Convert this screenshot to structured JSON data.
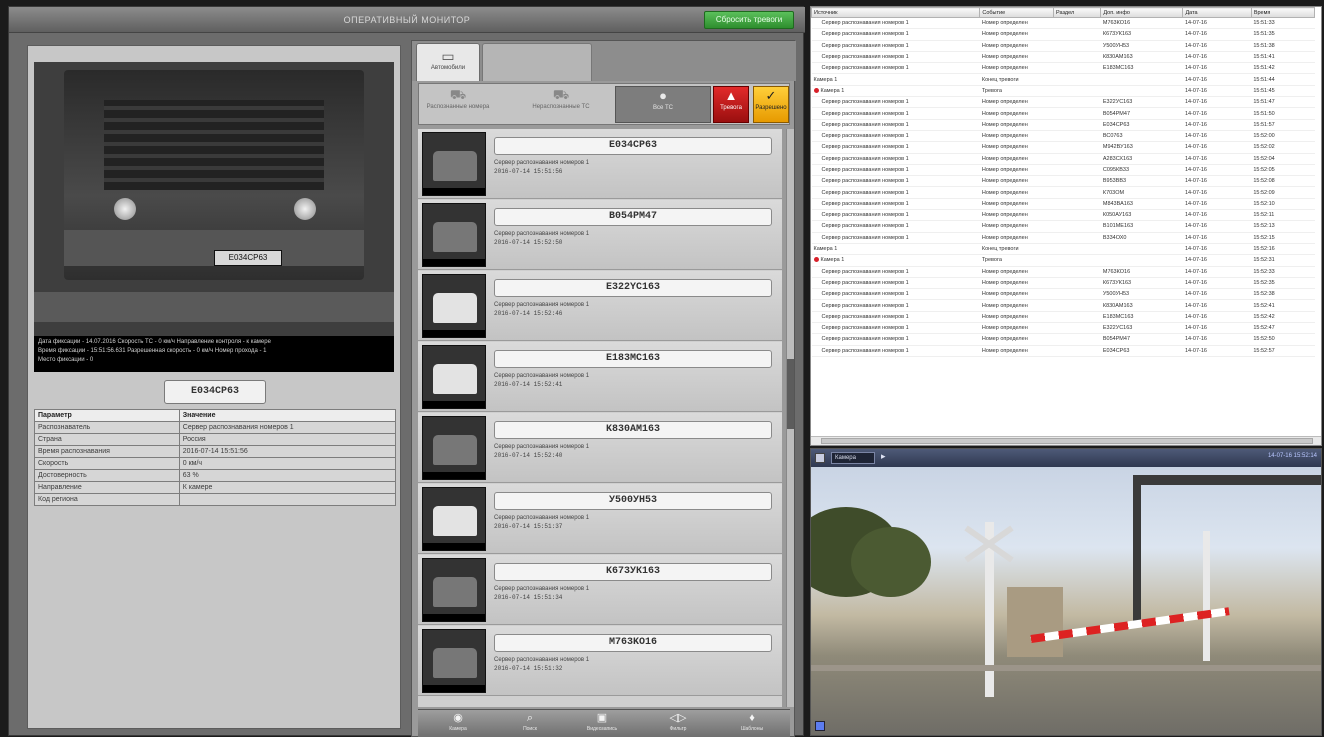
{
  "window": {
    "title": "ОПЕРАТИВНЫЙ МОНИТОР",
    "mode_button": "Сбросить тревоги"
  },
  "detail": {
    "photo_plate": "E034CP63",
    "caption": [
      "Дата фиксации - 14.07.2016 Скорость ТС - 0 км/ч Направление контроля - к камере",
      "Время фиксации - 15:51:56.631    Разрешенная скорость - 0 км/ч    Номер прохода - 1",
      "Место фиксации - 0"
    ],
    "plate": "E034CP63",
    "table_headers": [
      "Параметр",
      "Значение"
    ],
    "table_rows": [
      [
        "Распознаватель",
        "Сервер распознавания номеров 1"
      ],
      [
        "Страна",
        "Россия"
      ],
      [
        "Время распознавания",
        "2016-07-14 15:51:56"
      ],
      [
        "Скорость",
        "0 км/ч"
      ],
      [
        "Достоверность",
        "63 %"
      ],
      [
        "Направление",
        "К камере"
      ],
      [
        "Код региона",
        ""
      ]
    ]
  },
  "middle": {
    "tabs": [
      {
        "label": "Автомобили",
        "icon": "monitor-icon"
      },
      {
        "label": "",
        "icon": "blank"
      }
    ],
    "filters": [
      {
        "label": "Распознанные номера",
        "icon": "car-icon"
      },
      {
        "label": "Нераспознанные ТС",
        "icon": "car-question-icon"
      },
      {
        "label": "Все ТС",
        "icon": "circle-icon"
      },
      {
        "label": "Тревога",
        "icon": "alarm-icon"
      },
      {
        "label": "Разрешено",
        "icon": "check-icon"
      }
    ],
    "items": [
      {
        "plate": "E034CP63",
        "server": "Сервер распознавания номеров 1",
        "time": "2016-07-14 15:51:56",
        "light": false
      },
      {
        "plate": "B054PM47",
        "server": "Сервер распознавания номеров 1",
        "time": "2016-07-14 15:52:50",
        "light": false
      },
      {
        "plate": "E322YC163",
        "server": "Сервер распознавания номеров 1",
        "time": "2016-07-14 15:52:46",
        "light": true
      },
      {
        "plate": "E183MC163",
        "server": "Сервер распознавания номеров 1",
        "time": "2016-07-14 15:52:41",
        "light": true
      },
      {
        "plate": "K830AM163",
        "server": "Сервер распознавания номеров 1",
        "time": "2016-07-14 15:52:40",
        "light": false
      },
      {
        "plate": "У500УН53",
        "server": "Сервер распознавания номеров 1",
        "time": "2016-07-14 15:51:37",
        "light": true
      },
      {
        "plate": "K673УК163",
        "server": "Сервер распознавания номеров 1",
        "time": "2016-07-14 15:51:34",
        "light": false
      },
      {
        "plate": "M763KO16",
        "server": "Сервер распознавания номеров 1",
        "time": "2016-07-14 15:51:32",
        "light": false
      }
    ],
    "toolbar": [
      {
        "label": "Камера",
        "icon": "camera-icon"
      },
      {
        "label": "Поиск",
        "icon": "search-icon"
      },
      {
        "label": "Видеозапись",
        "icon": "video-icon"
      },
      {
        "label": "Фильтр",
        "icon": "filter-icon"
      },
      {
        "label": "Шаблоны",
        "icon": "pin-icon"
      }
    ]
  },
  "events": {
    "headers": [
      "Источник",
      "Событие",
      "Раздел",
      "Доп. инфо",
      "Дата",
      "Время"
    ],
    "rows": [
      {
        "kind": "srv",
        "source": "Сервер распознавания номеров 1",
        "event": "Номер определен",
        "info": "М763КО16",
        "date": "14-07-16",
        "time": "15:51:33"
      },
      {
        "kind": "srv",
        "source": "Сервер распознавания номеров 1",
        "event": "Номер определен",
        "info": "К673УК163",
        "date": "14-07-16",
        "time": "15:51:35"
      },
      {
        "kind": "srv",
        "source": "Сервер распознавания номеров 1",
        "event": "Номер определен",
        "info": "У500УН53",
        "date": "14-07-16",
        "time": "15:51:38"
      },
      {
        "kind": "srv",
        "source": "Сервер распознавания номеров 1",
        "event": "Номер определен",
        "info": "К830АМ163",
        "date": "14-07-16",
        "time": "15:51:41"
      },
      {
        "kind": "srv",
        "source": "Сервер распознавания номеров 1",
        "event": "Номер определен",
        "info": "Е183МС163",
        "date": "14-07-16",
        "time": "15:51:42"
      },
      {
        "kind": "group",
        "source": "Камера 1",
        "event": "Конец тревоги",
        "info": "",
        "date": "14-07-16",
        "time": "15:51:44"
      },
      {
        "kind": "alarm",
        "source": "Камера 1",
        "event": "Тревога",
        "info": "",
        "date": "14-07-16",
        "time": "15:51:45"
      },
      {
        "kind": "srv",
        "source": "Сервер распознавания номеров 1",
        "event": "Номер определен",
        "info": "Е322УС163",
        "date": "14-07-16",
        "time": "15:51:47"
      },
      {
        "kind": "srv",
        "source": "Сервер распознавания номеров 1",
        "event": "Номер определен",
        "info": "В054РМ47",
        "date": "14-07-16",
        "time": "15:51:50"
      },
      {
        "kind": "srv",
        "source": "Сервер распознавания номеров 1",
        "event": "Номер определен",
        "info": "Е034СР63",
        "date": "14-07-16",
        "time": "15:51:57"
      },
      {
        "kind": "srv",
        "source": "Сервер распознавания номеров 1",
        "event": "Номер определен",
        "info": "ВС0763",
        "date": "14-07-16",
        "time": "15:52:00"
      },
      {
        "kind": "srv",
        "source": "Сервер распознавания номеров 1",
        "event": "Номер определен",
        "info": "М942ВУ163",
        "date": "14-07-16",
        "time": "15:52:02"
      },
      {
        "kind": "srv",
        "source": "Сервер распознавания номеров 1",
        "event": "Номер определен",
        "info": "А283СХ163",
        "date": "14-07-16",
        "time": "15:52:04"
      },
      {
        "kind": "srv",
        "source": "Сервер распознавания номеров 1",
        "event": "Номер определен",
        "info": "С095КВ33",
        "date": "14-07-16",
        "time": "15:52:05"
      },
      {
        "kind": "srv",
        "source": "Сервер распознавания номеров 1",
        "event": "Номер определен",
        "info": "В953ВВ3",
        "date": "14-07-16",
        "time": "15:52:08"
      },
      {
        "kind": "srv",
        "source": "Сервер распознавания номеров 1",
        "event": "Номер определен",
        "info": "К703ОМ",
        "date": "14-07-16",
        "time": "15:52:09"
      },
      {
        "kind": "srv",
        "source": "Сервер распознавания номеров 1",
        "event": "Номер определен",
        "info": "М843ВА163",
        "date": "14-07-16",
        "time": "15:52:10"
      },
      {
        "kind": "srv",
        "source": "Сервер распознавания номеров 1",
        "event": "Номер определен",
        "info": "К050АУ163",
        "date": "14-07-16",
        "time": "15:52:11"
      },
      {
        "kind": "srv",
        "source": "Сервер распознавания номеров 1",
        "event": "Номер определен",
        "info": "В101МЕ163",
        "date": "14-07-16",
        "time": "15:52:13"
      },
      {
        "kind": "srv",
        "source": "Сервер распознавания номеров 1",
        "event": "Номер определен",
        "info": "В334ОХ0",
        "date": "14-07-16",
        "time": "15:52:15"
      },
      {
        "kind": "group",
        "source": "Камера 1",
        "event": "Конец тревоги",
        "info": "",
        "date": "14-07-16",
        "time": "15:52:16"
      },
      {
        "kind": "alarm",
        "source": "Камера 1",
        "event": "Тревога",
        "info": "",
        "date": "14-07-16",
        "time": "15:52:31"
      },
      {
        "kind": "srv",
        "source": "Сервер распознавания номеров 1",
        "event": "Номер определен",
        "info": "М763КО16",
        "date": "14-07-16",
        "time": "15:52:33"
      },
      {
        "kind": "srv",
        "source": "Сервер распознавания номеров 1",
        "event": "Номер определен",
        "info": "К673УК163",
        "date": "14-07-16",
        "time": "15:52:35"
      },
      {
        "kind": "srv",
        "source": "Сервер распознавания номеров 1",
        "event": "Номер определен",
        "info": "У500УН53",
        "date": "14-07-16",
        "time": "15:52:38"
      },
      {
        "kind": "srv",
        "source": "Сервер распознавания номеров 1",
        "event": "Номер определен",
        "info": "К830АМ163",
        "date": "14-07-16",
        "time": "15:52:41"
      },
      {
        "kind": "srv",
        "source": "Сервер распознавания номеров 1",
        "event": "Номер определен",
        "info": "Е183МС163",
        "date": "14-07-16",
        "time": "15:52:42"
      },
      {
        "kind": "srv",
        "source": "Сервер распознавания номеров 1",
        "event": "Номер определен",
        "info": "Е322УС163",
        "date": "14-07-16",
        "time": "15:52:47"
      },
      {
        "kind": "srv",
        "source": "Сервер распознавания номеров 1",
        "event": "Номер определен",
        "info": "В054РМ47",
        "date": "14-07-16",
        "time": "15:52:50"
      },
      {
        "kind": "srv",
        "source": "Сервер распознавания номеров 1",
        "event": "Номер определен",
        "info": "Е034СР63",
        "date": "14-07-16",
        "time": "15:52:57"
      }
    ]
  },
  "camera": {
    "name": "Камера",
    "play_icon": "play-icon",
    "timestamp": "14-07-16   15:52:14"
  },
  "colors": {
    "accent_green": "#2e8e2e",
    "alarm_red": "#d8202a",
    "ok_yellow": "#f0b41a"
  }
}
